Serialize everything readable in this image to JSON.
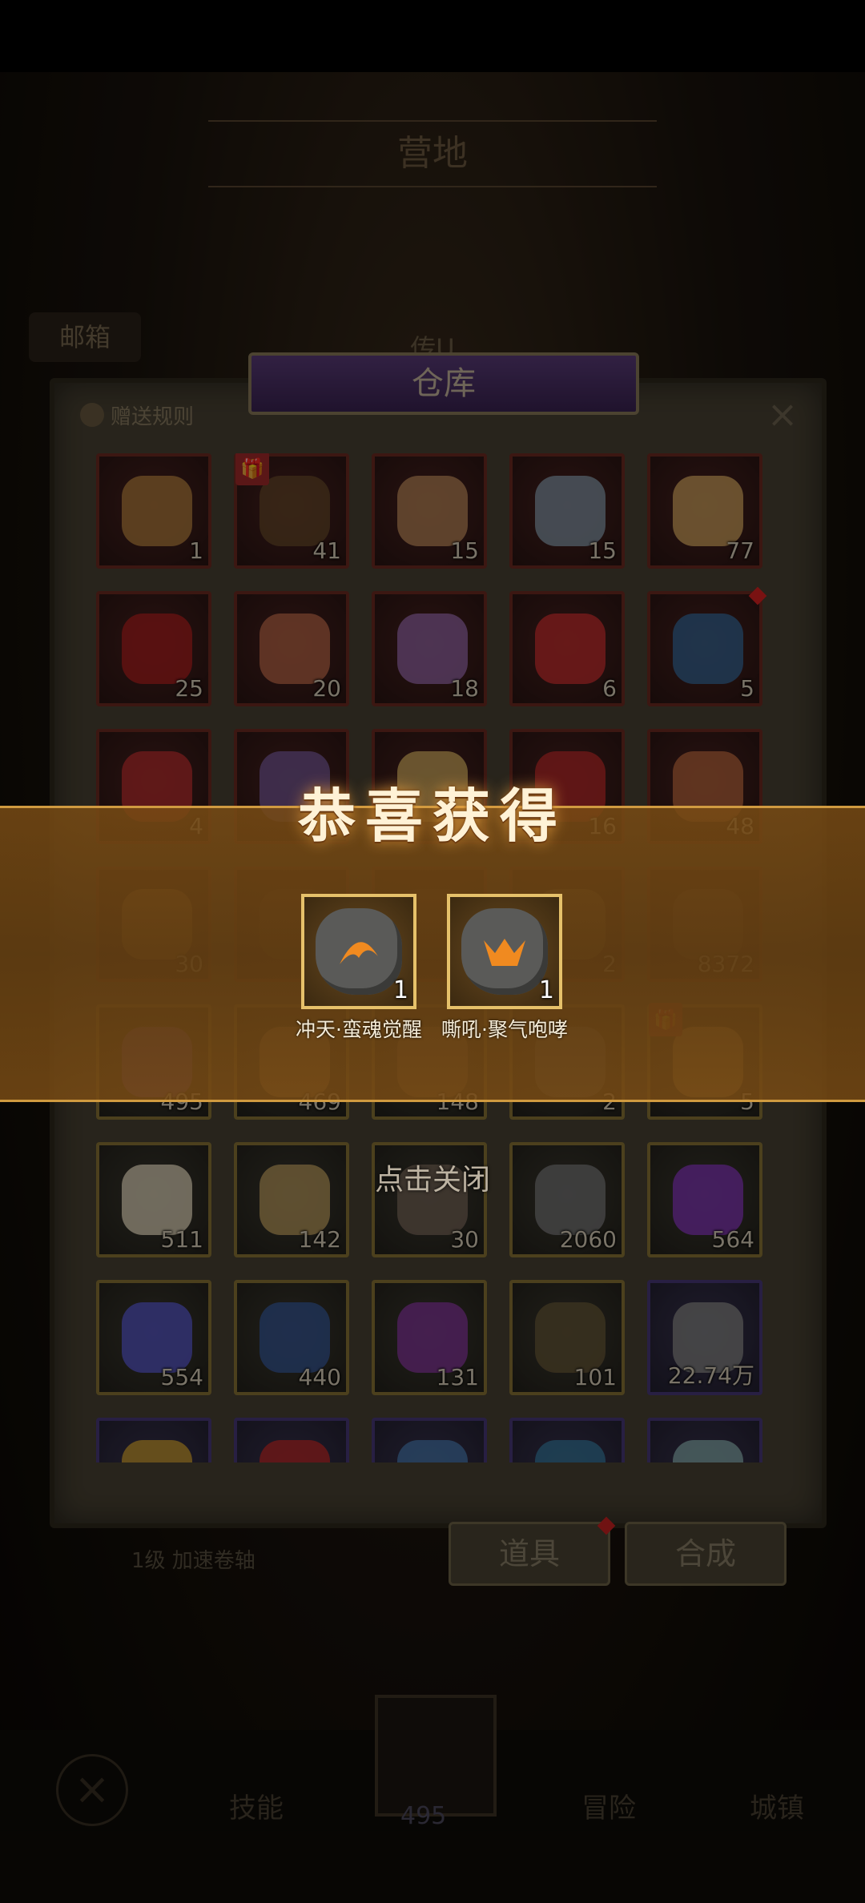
{
  "background": {
    "camp_title": "营地",
    "mailbox_label": "邮箱",
    "tab_behind": "传U"
  },
  "warehouse": {
    "title": "仓库",
    "rules_label": "赠送规则",
    "close_symbol": "×",
    "items": [
      {
        "count": "1",
        "frame": "red",
        "color": "#b88040"
      },
      {
        "count": "41",
        "frame": "red",
        "color": "#6a4a2a",
        "gift": true
      },
      {
        "count": "15",
        "frame": "red",
        "color": "#c08a5a"
      },
      {
        "count": "15",
        "frame": "red",
        "color": "#8a9aaa"
      },
      {
        "count": "77",
        "frame": "red",
        "color": "#d8a860"
      },
      {
        "count": "25",
        "frame": "red",
        "color": "#b02020"
      },
      {
        "count": "20",
        "frame": "red",
        "color": "#c06a4a"
      },
      {
        "count": "18",
        "frame": "red",
        "color": "#9a6aaa"
      },
      {
        "count": "6",
        "frame": "red",
        "color": "#d03030"
      },
      {
        "count": "5",
        "frame": "red",
        "color": "#3a6a9a",
        "dot": true
      },
      {
        "count": "4",
        "frame": "red",
        "color": "#c03030"
      },
      {
        "count": "",
        "frame": "red",
        "color": "#7a5a9a"
      },
      {
        "count": "",
        "frame": "red",
        "color": "#d8b060"
      },
      {
        "count": "16",
        "frame": "red",
        "color": "#c02a2a"
      },
      {
        "count": "48",
        "frame": "red",
        "color": "#c06a40"
      },
      {
        "count": "30",
        "frame": "red",
        "color": "#b8803a"
      },
      {
        "count": "",
        "frame": "red",
        "color": "#5a3a2a"
      },
      {
        "count": "",
        "frame": "red",
        "color": "#5a3a2a"
      },
      {
        "count": "2",
        "frame": "red",
        "color": "#8a6a3a"
      },
      {
        "count": "8372",
        "frame": "red",
        "color": "#6a4a3a"
      },
      {
        "count": "495",
        "frame": "gold",
        "color": "#7a4ab0"
      },
      {
        "count": "469",
        "frame": "gold",
        "color": "#b88a50"
      },
      {
        "count": "148",
        "frame": "gold",
        "color": "#8a6a4a"
      },
      {
        "count": "2",
        "frame": "gold",
        "color": "#6a6a6a"
      },
      {
        "count": "5",
        "frame": "gold",
        "color": "#c89a50",
        "gift": true
      },
      {
        "count": "511",
        "frame": "gold",
        "color": "#e8dcc0"
      },
      {
        "count": "142",
        "frame": "gold",
        "color": "#c0a060"
      },
      {
        "count": "30",
        "frame": "gold",
        "color": "#7a6a5a"
      },
      {
        "count": "2060",
        "frame": "gold",
        "color": "#7a7a7a"
      },
      {
        "count": "564",
        "frame": "gold",
        "color": "#8a3ac0"
      },
      {
        "count": "554",
        "frame": "gold",
        "color": "#5a5ad0"
      },
      {
        "count": "440",
        "frame": "gold",
        "color": "#3a5a9a"
      },
      {
        "count": "131",
        "frame": "gold",
        "color": "#8a3aa0"
      },
      {
        "count": "101",
        "frame": "gold",
        "color": "#6a5a3a"
      },
      {
        "count": "22.74万",
        "frame": "purple",
        "color": "#8a8a8a"
      },
      {
        "count": "",
        "frame": "purple",
        "color": "#d0a030"
      },
      {
        "count": "",
        "frame": "purple",
        "color": "#c02a2a"
      },
      {
        "count": "",
        "frame": "purple",
        "color": "#4a7ab0"
      },
      {
        "count": "",
        "frame": "purple",
        "color": "#3a7aa0"
      },
      {
        "count": "",
        "frame": "purple",
        "color": "#8ab0b0"
      }
    ],
    "tabs": [
      {
        "label": "道具",
        "dot": true
      },
      {
        "label": "合成",
        "dot": false
      }
    ],
    "footer_note": "1级 加速卷轴"
  },
  "nav": {
    "close_symbol": "×",
    "skills": "技能",
    "adventure": "冒险",
    "town": "城镇",
    "center_count": "495"
  },
  "reward_popup": {
    "title": "恭喜获得",
    "items": [
      {
        "name": "冲天·蛮魂觉醒",
        "count": "1",
        "glyph": "♨"
      },
      {
        "name": "嘶吼·聚气咆哮",
        "count": "1",
        "glyph": "♨"
      }
    ],
    "tap_to_close": "点击关闭"
  },
  "colors": {
    "banner_gold": "#d09a40",
    "reward_frame": "#e6c16a",
    "frame_red": "#6d2a22",
    "frame_gold": "#8a7636",
    "frame_purple": "#4a3a7a"
  }
}
